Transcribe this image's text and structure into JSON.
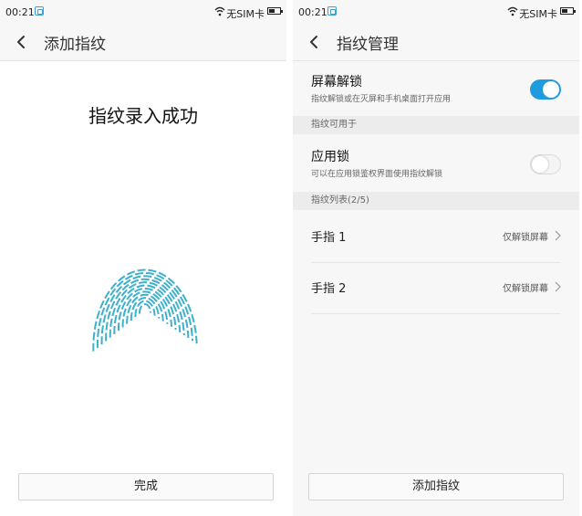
{
  "left_screen": {
    "status_bar": {
      "time": "00:21",
      "sim_status": "无SIM卡"
    },
    "header": {
      "title": "添加指纹"
    },
    "message": "指纹录入成功",
    "done_button": "完成"
  },
  "right_screen": {
    "status_bar": {
      "time": "00:21",
      "sim_status": "无SIM卡"
    },
    "header": {
      "title": "指纹管理"
    },
    "screen_unlock": {
      "label": "屏幕解锁",
      "description": "指纹解锁或在灭屏和手机桌面打开应用",
      "enabled": true
    },
    "section_usage": "指纹可用于",
    "app_lock": {
      "label": "应用锁",
      "description": "可以在应用锁鉴权界面使用指纹解锁",
      "enabled": false
    },
    "section_list": "指纹列表(2/5)",
    "fingers": [
      {
        "name": "手指 1",
        "status": "仅解锁屏幕"
      },
      {
        "name": "手指 2",
        "status": "仅解锁屏幕"
      }
    ],
    "add_button": "添加指纹"
  },
  "colors": {
    "accent": "#1e9cde",
    "fingerprint": "#3db0cc"
  }
}
